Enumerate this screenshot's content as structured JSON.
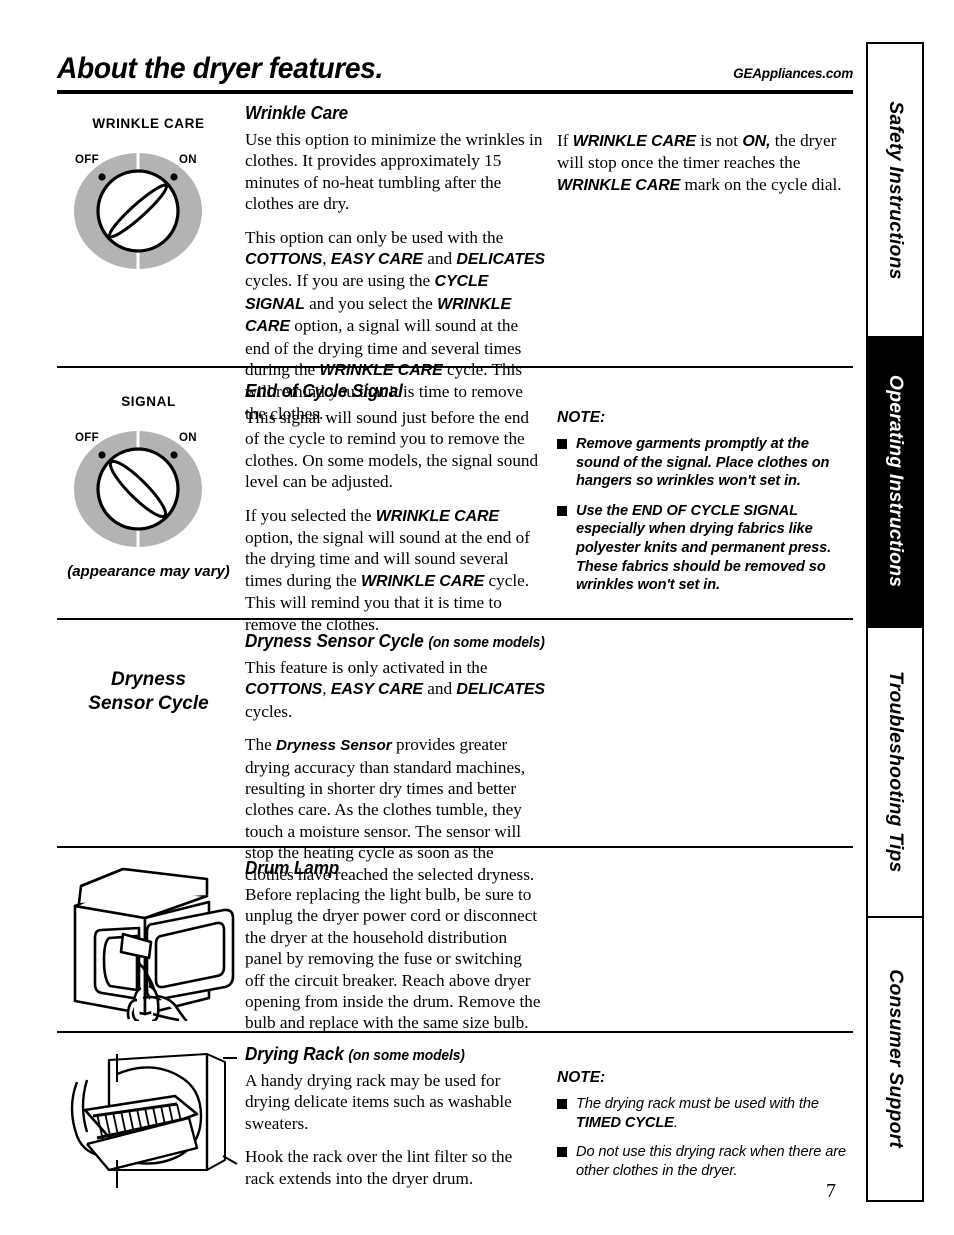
{
  "header": {
    "title": "About the dryer features.",
    "site_url": "GEAppliances.com"
  },
  "sidebar": {
    "tabs": [
      {
        "label": "Safety Instructions",
        "active": false
      },
      {
        "label": "Operating Instructions",
        "active": true
      },
      {
        "label": "Troubleshooting Tips",
        "active": false
      },
      {
        "label": "Consumer Support",
        "active": false
      }
    ]
  },
  "page_number": "7",
  "sections": [
    {
      "id": "wrinkle-care",
      "heading": "Wrinkle Care",
      "knob_label": "WRINKLE CARE",
      "knob_off": "OFF",
      "knob_on": "ON",
      "paragraphs": [
        "Use this option to minimize the wrinkles in clothes. It provides approximately 15 minutes of no-heat tumbling after the clothes are dry.",
        "This option can only be used with the COTTONS, EASY CARE and DELICATES cycles. If you are using the CYCLE SIGNAL and you select the WRINKLE CARE option, a signal will sound at the end of the drying time and several times during the WRINKLE CARE cycle. This will remind you that it is time to remove the clothes."
      ],
      "right_paragraph": "If WRINKLE CARE is not ON, the dryer will stop once the timer reaches the WRINKLE CARE mark on the cycle dial."
    },
    {
      "id": "end-of-cycle-signal",
      "heading": "End of Cycle Signal",
      "knob_label": "SIGNAL",
      "knob_off": "OFF",
      "knob_on": "ON",
      "knob_caption": "(appearance may vary)",
      "paragraphs": [
        "This signal will sound just before the end of the cycle to remind you to remove the clothes. On some models, the signal sound level can be adjusted.",
        "If you selected the WRINKLE CARE option, the signal will sound at the end of the drying time and will sound several times during the WRINKLE CARE cycle. This will remind you that it is time to remove the clothes."
      ],
      "note_title": "NOTE:",
      "notes": [
        "Remove garments promptly at the sound of the signal. Place clothes on hangers so wrinkles won't set in.",
        "Use the END OF CYCLE SIGNAL especially when drying fabrics like polyester knits and permanent press. These fabrics should be removed so wrinkles won't set in."
      ]
    },
    {
      "id": "dryness-sensor-cycle",
      "heading": "Dryness Sensor Cycle",
      "heading_note": "(on some models)",
      "side_label": "Dryness\nSensor Cycle",
      "side_label_line1": "Dryness",
      "side_label_line2": "Sensor Cycle",
      "paragraphs": [
        "This feature is only activated in the COTTONS, EASY CARE and DELICATES cycles.",
        "The Dryness Sensor provides greater drying accuracy than standard machines, resulting in shorter dry times and better clothes care. As the clothes tumble, they touch a moisture sensor. The sensor will stop the heating cycle as soon as the clothes have reached the selected dryness."
      ]
    },
    {
      "id": "drum-lamp",
      "heading": "Drum Lamp",
      "illustration": "dryer-with-open-door-and-hand",
      "paragraphs": [
        "Before replacing the light bulb, be sure to unplug the dryer power cord or disconnect the dryer at the household distribution panel by removing the fuse or switching off the circuit breaker. Reach above dryer opening from inside the drum. Remove the bulb and replace with the same size bulb."
      ]
    },
    {
      "id": "drying-rack",
      "heading": "Drying Rack",
      "heading_note": "(on some models)",
      "illustration": "drying-rack-in-dryer-drum",
      "paragraphs": [
        "A handy drying rack may be used for drying delicate items such as washable sweaters.",
        "Hook the rack over the lint filter so the rack extends into the dryer drum."
      ],
      "note_title": "NOTE:",
      "notes": [
        "The drying rack must be used with the TIMED CYCLE.",
        "Do not use this drying rack when there are other clothes in the dryer."
      ]
    }
  ],
  "text_fragments": {
    "wc_p1": "Use this option to minimize the wrinkles in clothes. It provides approximately 15 minutes of no-heat tumbling after the clothes are dry.",
    "cottons": "COTTONS",
    "easy_care": "EASY CARE",
    "delicates": "DELICATES",
    "cycle_signal": "CYCLE SIGNAL",
    "wrinkle_care": "WRINKLE CARE",
    "on": "ON,",
    "dryness_sensor": "Dryness Sensor",
    "timed_cycle": "TIMED CYCLE",
    "end_of_cycle_signal_caps": "END OF CYCLE SIGNAL"
  },
  "colors": {
    "knob_gray": "#b3b3b3",
    "ink": "#000000",
    "paper": "#ffffff"
  }
}
